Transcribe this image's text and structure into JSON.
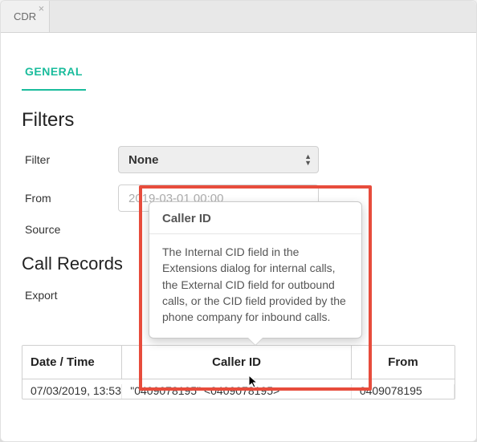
{
  "tabs": {
    "main": "CDR"
  },
  "innerTabs": {
    "general": "GENERAL"
  },
  "filters": {
    "heading": "Filters",
    "filterLabel": "Filter",
    "filterValue": "None",
    "fromLabel": "From",
    "fromValue": "2019-03-01 00:00",
    "sourceLabel": "Source"
  },
  "records": {
    "heading": "Call Records",
    "exportLabel": "Export"
  },
  "tooltip": {
    "title": "Caller ID",
    "body": "The Internal CID field in the Extensions dialog for internal calls, the External CID field for outbound calls, or the CID field provided by the phone company for inbound calls."
  },
  "table": {
    "headers": {
      "datetime": "Date / Time",
      "callerId": "Caller ID",
      "from": "From"
    },
    "rows": [
      {
        "datetime": "07/03/2019, 13:53",
        "callerId": "\"0409078195\" <0409078195>",
        "from": "0409078195"
      }
    ]
  }
}
